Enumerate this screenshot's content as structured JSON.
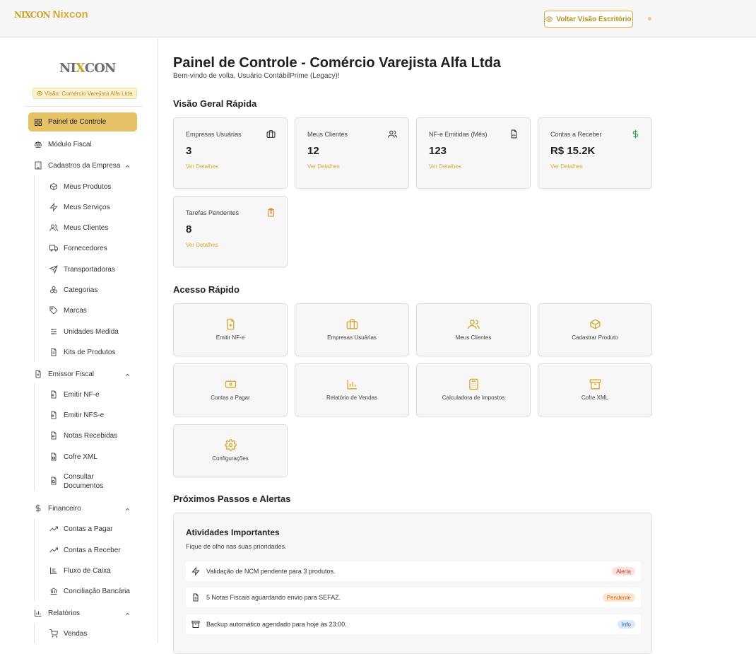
{
  "topbar": {
    "logo_mark": "NIXCON",
    "brand_name": "Nixcon",
    "back_button": "Voltar Visão Escritório"
  },
  "sidebar": {
    "logo_left": "NI",
    "logo_x": "X",
    "logo_right": "CON",
    "vision_badge": "Visão: Comércio Varejista Alfa Ltda",
    "items": {
      "painel": "Painel de Controle",
      "modulo_fiscal": "Módulo Fiscal",
      "cadastros": "Cadastros da Empresa",
      "produtos": "Meus Produtos",
      "servicos": "Meus Serviços",
      "clientes": "Meus Clientes",
      "fornecedores": "Fornecedores",
      "transportadoras": "Transportadoras",
      "categorias": "Categorias",
      "marcas": "Marcas",
      "unidades": "Unidades Medida",
      "kits": "Kits de Produtos",
      "emissor": "Emissor Fiscal",
      "emitir_nfe": "Emitir NF-e",
      "emitir_nfse": "Emitir NFS-e",
      "notas_recebidas": "Notas Recebidas",
      "cofre": "Cofre XML",
      "consultar_1": "Consultar",
      "consultar_2": "Documentos",
      "financeiro": "Financeiro",
      "pagar": "Contas a Pagar",
      "receber": "Contas a Receber",
      "fluxo": "Fluxo de Caixa",
      "conciliacao": "Conciliação Bancária",
      "relatorios": "Relatórios",
      "vendas": "Vendas"
    }
  },
  "main": {
    "title": "Painel de Controle - Comércio Varejista Alfa Ltda",
    "subtitle": "Bem-vindo de volta, Usuário ContábilPrime (Legacy)!",
    "overview_title": "Visão Geral Rápida",
    "stats": [
      {
        "label": "Empresas Usuárias",
        "value": "3",
        "link": "Ver Detalhes"
      },
      {
        "label": "Meus Clientes",
        "value": "12",
        "link": "Ver Detalhes"
      },
      {
        "label": "NF-e Emitidas (Mês)",
        "value": "123",
        "link": "Ver Detalhes"
      },
      {
        "label": "Contas a Receber",
        "value": "R$ 15.2K",
        "link": "Ver Detalhes"
      },
      {
        "label": "Tarefas Pendentes",
        "value": "8",
        "link": "Ver Detalhes"
      }
    ],
    "quick_title": "Acesso Rápido",
    "quick": [
      "Emitir NF-e",
      "Empresas Usuárias",
      "Meus Clientes",
      "Cadastrar Produto",
      "Contas a Pagar",
      "Relatório de Vendas",
      "Calculadora de Impostos",
      "Cofre XML",
      "Configurações"
    ],
    "alerts_title": "Próximos Passos e Alertas",
    "panel": {
      "title": "Atividades Importantes",
      "subtitle": "Fique de olho nas suas prioridades.",
      "rows": [
        {
          "text": "Validação de NCM pendente para 3 produtos.",
          "badge": "Alerta"
        },
        {
          "text": "5 Notas Fiscais aguardando envio para SEFAZ.",
          "badge": "Pendente"
        },
        {
          "text": "Backup automático agendado para hoje às 23:00.",
          "badge": "Info"
        }
      ]
    }
  },
  "colors": {
    "accent": "#d6ad3a",
    "active_nav": "#e6c267",
    "badge_alert_bg": "#fde2e2",
    "badge_pending_bg": "#fde5d4",
    "badge_info_bg": "#dde8fb"
  }
}
